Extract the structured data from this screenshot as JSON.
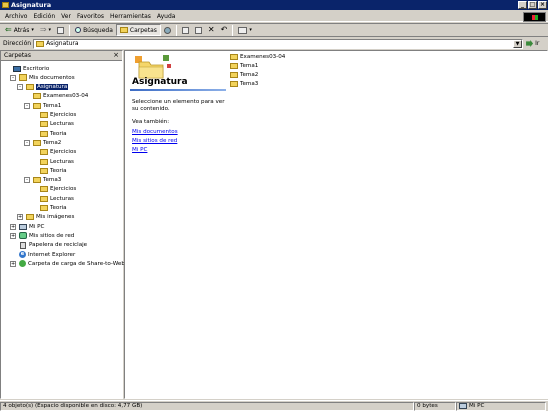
{
  "window": {
    "title": "Asignatura"
  },
  "menu": [
    "Archivo",
    "Edición",
    "Ver",
    "Favoritos",
    "Herramientas",
    "Ayuda"
  ],
  "toolbar": {
    "back_label": "Atrás",
    "search_label": "Búsqueda",
    "folders_label": "Carpetas"
  },
  "address": {
    "label": "Dirección",
    "value": "Asignatura",
    "go_label": "Ir"
  },
  "folders_panel": {
    "title": "Carpetas",
    "close": "×",
    "tree": [
      {
        "label": "Escritorio",
        "icon": "desktop-icon"
      },
      {
        "label": "Mis documentos",
        "icon": "my-documents-icon",
        "expander": "-"
      },
      {
        "label": "Asignatura",
        "icon": "folder-icon",
        "expander": "-",
        "selected": true
      },
      {
        "label": "Examenes03-04",
        "icon": "folder-icon"
      },
      {
        "label": "Tema1",
        "icon": "folder-icon",
        "expander": "-"
      },
      {
        "label": "Ejercicios",
        "icon": "folder-icon"
      },
      {
        "label": "Lecturas",
        "icon": "folder-icon"
      },
      {
        "label": "Teoria",
        "icon": "folder-icon"
      },
      {
        "label": "Tema2",
        "icon": "folder-icon",
        "expander": "-"
      },
      {
        "label": "Ejercicios",
        "icon": "folder-icon"
      },
      {
        "label": "Lecturas",
        "icon": "folder-icon"
      },
      {
        "label": "Teoria",
        "icon": "folder-icon"
      },
      {
        "label": "Tema3",
        "icon": "folder-icon",
        "expander": "-"
      },
      {
        "label": "Ejercicios",
        "icon": "folder-icon"
      },
      {
        "label": "Lecturas",
        "icon": "folder-icon"
      },
      {
        "label": "Teoria",
        "icon": "folder-icon"
      },
      {
        "label": "Mis imágenes",
        "icon": "my-pictures-icon",
        "expander": "+"
      },
      {
        "label": "Mi PC",
        "icon": "computer-icon",
        "expander": "+"
      },
      {
        "label": "Mis sitios de red",
        "icon": "network-icon",
        "expander": "+"
      },
      {
        "label": "Papelera de reciclaje",
        "icon": "recycle-bin-icon"
      },
      {
        "label": "Internet Explorer",
        "icon": "ie-icon"
      },
      {
        "label": "Carpeta de carga de Share-to-Web",
        "icon": "share-icon",
        "expander": "+"
      }
    ]
  },
  "webview": {
    "title": "Asignatura",
    "prompt": "Seleccione un elemento para ver su contenido.",
    "see_also": "Vea también:",
    "links": [
      "Mis documentos",
      "Mis sitios de red",
      "Mi PC"
    ]
  },
  "files": [
    "Examenes03-04",
    "Tema1",
    "Tema2",
    "Tema3"
  ],
  "status": {
    "objects": "4 objeto(s) (Espacio disponible en disco: 4,77 GB)",
    "size": "0 bytes",
    "zone": "Mi PC"
  }
}
